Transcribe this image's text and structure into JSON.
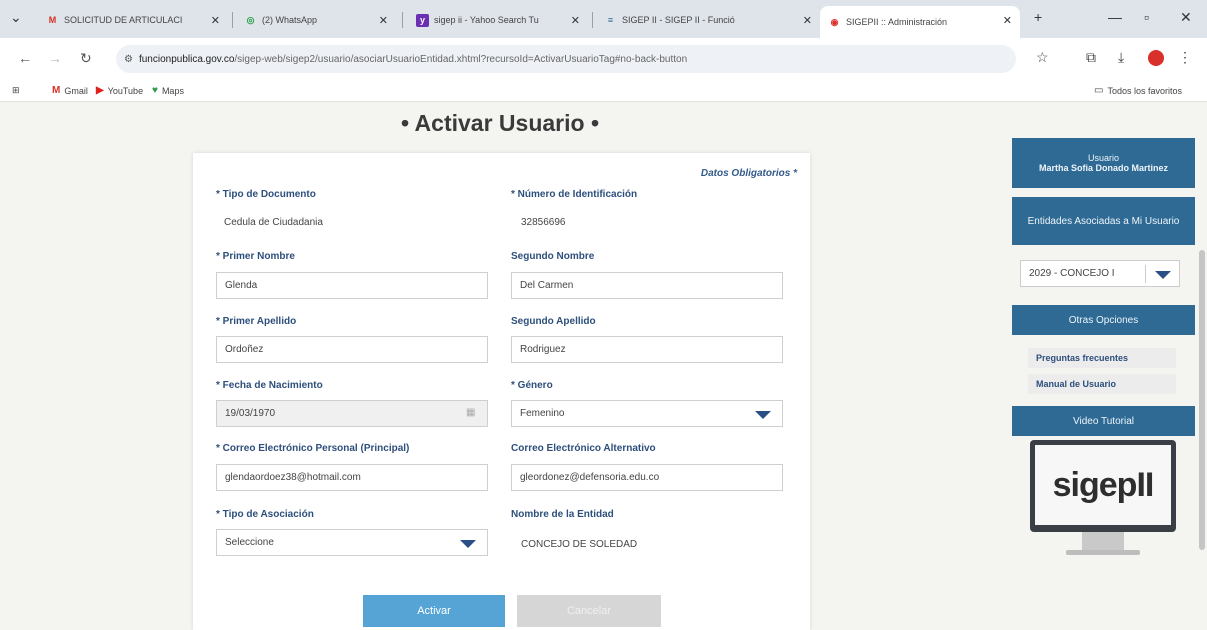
{
  "browser": {
    "tabs": [
      {
        "label": "SOLICITUD DE ARTICULACI",
        "icon": "M",
        "icon_color": "#d93025"
      },
      {
        "label": "(2) WhatsApp",
        "icon": "◎",
        "icon_color": "#25a244"
      },
      {
        "label": "sigep ii - Yahoo Search Tu",
        "icon": "y",
        "icon_color": "#6b2fb3"
      },
      {
        "label": "SIGEP II - SIGEP II - Funció",
        "icon": "≡",
        "icon_color": "#2e6a94"
      },
      {
        "label": "SIGEPII :: Administración",
        "icon": "◉",
        "icon_color": "#d9302b"
      }
    ],
    "url_host": "funcionpublica.gov.co",
    "url_path": "/sigep-web/sigep2/usuario/asociarUsuarioEntidad.xhtml?recursoId=ActivarUsuarioTag#no-back-button",
    "bookmarks": [
      {
        "label": "Gmail",
        "icon": "M"
      },
      {
        "label": "YouTube",
        "icon": "▶"
      },
      {
        "label": "Maps",
        "icon": "♥"
      }
    ],
    "all_bookmarks": "Todos los favoritos"
  },
  "page": {
    "title": "• Activar Usuario •",
    "required_note": "Datos Obligatorios *"
  },
  "form": {
    "tipo_doc": {
      "label": "* Tipo de Documento",
      "value": "Cedula de Ciudadania"
    },
    "num_id": {
      "label": "* Número de Identificación",
      "value": "32856696"
    },
    "primer_nombre": {
      "label": "* Primer Nombre",
      "value": "Glenda"
    },
    "segundo_nombre": {
      "label": "Segundo Nombre",
      "value": "Del Carmen"
    },
    "primer_apellido": {
      "label": "* Primer Apellido",
      "value": "Ordoñez"
    },
    "segundo_apellido": {
      "label": "Segundo Apellido",
      "value": "Rodriguez"
    },
    "fecha_nac": {
      "label": "* Fecha de Nacimiento",
      "value": "19/03/1970"
    },
    "genero": {
      "label": "* Género",
      "value": "Femenino"
    },
    "correo_principal": {
      "label": "* Correo Electrónico Personal (Principal)",
      "value": "glendaordoez38@hotmail.com"
    },
    "correo_alt": {
      "label": "Correo Electrónico Alternativo",
      "value": "gleordonez@defensoria.edu.co"
    },
    "tipo_asoc": {
      "label": "* Tipo de Asociación",
      "value": "Seleccione"
    },
    "entidad": {
      "label": "Nombre de la Entidad",
      "value": "CONCEJO DE SOLEDAD"
    },
    "activar_label": "Activar",
    "cancelar_label": "Cancelar"
  },
  "sidebar": {
    "user_label": "Usuario",
    "user_name": "Martha Sofia Donado Martinez",
    "entidades_label": "Entidades Asociadas a Mi Usuario",
    "entidad_selected": "2029 - CONCEJO I",
    "otras_label": "Otras Opciones",
    "links": [
      "Preguntas frecuentes",
      "Manual de Usuario"
    ],
    "video_label": "Video Tutorial",
    "logo_text": "sigepII"
  }
}
